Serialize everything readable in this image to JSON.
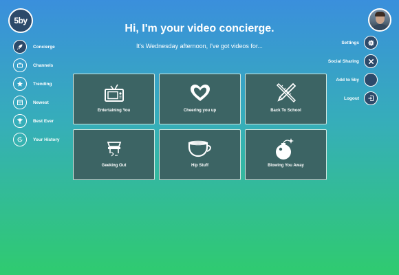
{
  "logo": {
    "text": "5by"
  },
  "header": {
    "title": "Hi, I'm your video concierge.",
    "subtitle": "It's Wednesday afternoon, I've got videos for..."
  },
  "sidebar": {
    "items": [
      {
        "label": "Concierge",
        "icon": "rocket-icon",
        "active": true
      },
      {
        "label": "Channels",
        "icon": "tv-icon"
      },
      {
        "label": "Trending",
        "icon": "star-icon"
      },
      {
        "label": "Newest",
        "icon": "calendar-icon"
      },
      {
        "label": "Best Ever",
        "icon": "trophy-icon"
      },
      {
        "label": "Your History",
        "icon": "history-icon"
      }
    ]
  },
  "account_menu": {
    "items": [
      {
        "label": "Settings",
        "icon": "gear-icon"
      },
      {
        "label": "Social Sharing",
        "icon": "close-icon"
      },
      {
        "label": "Add to 5by",
        "icon": ""
      },
      {
        "label": "Logout",
        "icon": "logout-icon"
      }
    ]
  },
  "tiles": [
    {
      "label": "Entertaining You",
      "icon": "retro-tv-icon"
    },
    {
      "label": "Cheering you up",
      "icon": "heart-icon"
    },
    {
      "label": "Back To School",
      "icon": "pencil-ruler-icon"
    },
    {
      "label": "Geeking Out",
      "icon": "projector-icon"
    },
    {
      "label": "Hip Stuff",
      "icon": "teacup-icon"
    },
    {
      "label": "Blowing You Away",
      "icon": "bomb-icon"
    }
  ],
  "colors": {
    "gradient_top": "#3a8fdc",
    "gradient_bottom": "#2fcb6f",
    "tile_bg": "#3c6464",
    "circle_dark": "#2c4a6a"
  }
}
